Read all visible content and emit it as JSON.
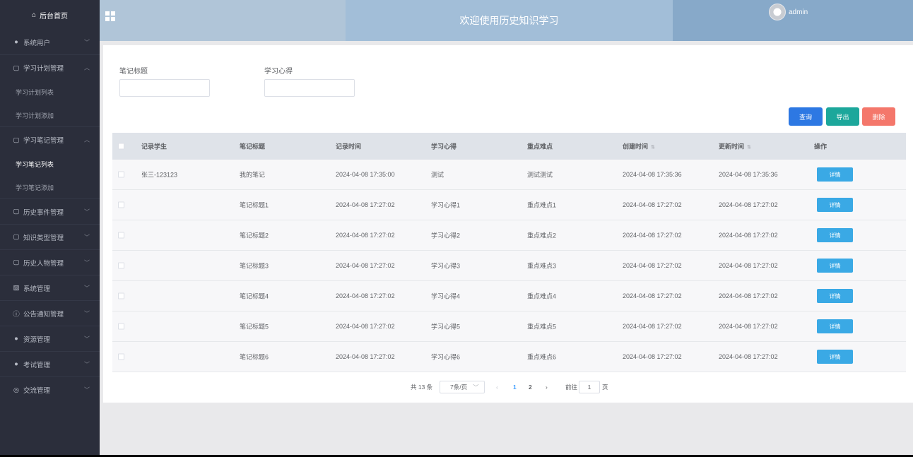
{
  "sidebar": {
    "home_label": "后台首页",
    "groups": [
      {
        "label": "系统用户"
      },
      {
        "label": "学习计划管理",
        "subs": [
          "学习计划列表",
          "学习计划添加"
        ]
      },
      {
        "label": "学习笔记管理",
        "subs": [
          "学习笔记列表",
          "学习笔记添加"
        ]
      },
      {
        "label": "历史事件管理"
      },
      {
        "label": "知识类型管理"
      },
      {
        "label": "历史人物管理"
      },
      {
        "label": "系统管理"
      },
      {
        "label": "公告通知管理"
      },
      {
        "label": "资源管理"
      },
      {
        "label": "考试管理"
      },
      {
        "label": "交流管理"
      }
    ]
  },
  "header": {
    "title": "欢迎使用历史知识学习",
    "username": "admin"
  },
  "search": {
    "title_label": "笔记标题",
    "title_value": "",
    "insight_label": "学习心得",
    "insight_value": ""
  },
  "buttons": {
    "query": "查询",
    "export": "导出",
    "delete": "删除",
    "detail": "详情"
  },
  "table": {
    "headers": [
      "记录学生",
      "笔记标题",
      "记录时间",
      "学习心得",
      "重点难点",
      "创建时间",
      "更新时间",
      "操作"
    ],
    "rows": [
      {
        "student": "张三-123123",
        "title": "我的笔记",
        "record_time": "2024-04-08 17:35:00",
        "insight": "测试",
        "key_points": "测试测试",
        "created": "2024-04-08 17:35:36",
        "updated": "2024-04-08 17:35:36"
      },
      {
        "student": "",
        "title": "笔记标题1",
        "record_time": "2024-04-08 17:27:02",
        "insight": "学习心得1",
        "key_points": "重点难点1",
        "created": "2024-04-08 17:27:02",
        "updated": "2024-04-08 17:27:02"
      },
      {
        "student": "",
        "title": "笔记标题2",
        "record_time": "2024-04-08 17:27:02",
        "insight": "学习心得2",
        "key_points": "重点难点2",
        "created": "2024-04-08 17:27:02",
        "updated": "2024-04-08 17:27:02"
      },
      {
        "student": "",
        "title": "笔记标题3",
        "record_time": "2024-04-08 17:27:02",
        "insight": "学习心得3",
        "key_points": "重点难点3",
        "created": "2024-04-08 17:27:02",
        "updated": "2024-04-08 17:27:02"
      },
      {
        "student": "",
        "title": "笔记标题4",
        "record_time": "2024-04-08 17:27:02",
        "insight": "学习心得4",
        "key_points": "重点难点4",
        "created": "2024-04-08 17:27:02",
        "updated": "2024-04-08 17:27:02"
      },
      {
        "student": "",
        "title": "笔记标题5",
        "record_time": "2024-04-08 17:27:02",
        "insight": "学习心得5",
        "key_points": "重点难点5",
        "created": "2024-04-08 17:27:02",
        "updated": "2024-04-08 17:27:02"
      },
      {
        "student": "",
        "title": "笔记标题6",
        "record_time": "2024-04-08 17:27:02",
        "insight": "学习心得6",
        "key_points": "重点难点6",
        "created": "2024-04-08 17:27:02",
        "updated": "2024-04-08 17:27:02"
      }
    ]
  },
  "pagination": {
    "total": "共 13 条",
    "page_size": "7条/页",
    "pages": [
      "1",
      "2"
    ],
    "current_page": "1",
    "goto_label": "前往",
    "goto_value": "1",
    "page_unit": "页"
  },
  "colors": {
    "sidebar_bg": "#2b2e3b",
    "query": "#2d78e3",
    "export": "#1ca79b",
    "delete": "#f4776b",
    "detail": "#3aa9e5"
  }
}
